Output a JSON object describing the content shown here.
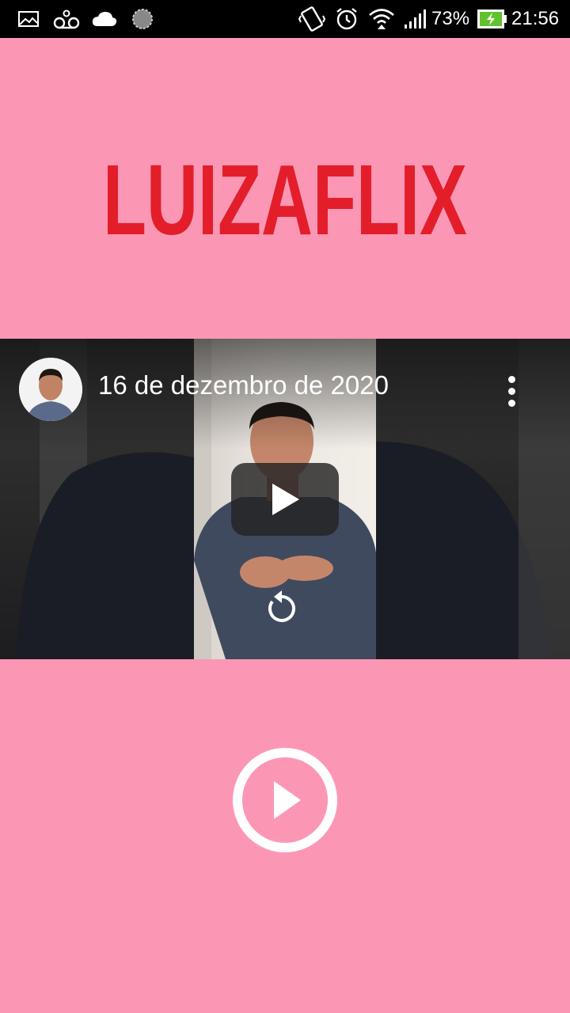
{
  "status_bar": {
    "battery_percent": "73%",
    "time": "21:56",
    "icons": [
      "gallery-icon",
      "voicemail-icon",
      "cloud-icon",
      "sync-icon",
      "vibrate-icon",
      "alarm-icon",
      "wifi-icon",
      "signal-icon",
      "battery-charging-icon"
    ]
  },
  "logo": {
    "text": "LUIZAFLIX",
    "color": "#e31e2a"
  },
  "video": {
    "title": "16 de dezembro de 2020",
    "controls": [
      "play-icon",
      "replay-icon",
      "more-vert-icon"
    ]
  },
  "colors": {
    "background": "#fb97b4",
    "status_bar": "#000000",
    "play_button": "#ffffff"
  }
}
